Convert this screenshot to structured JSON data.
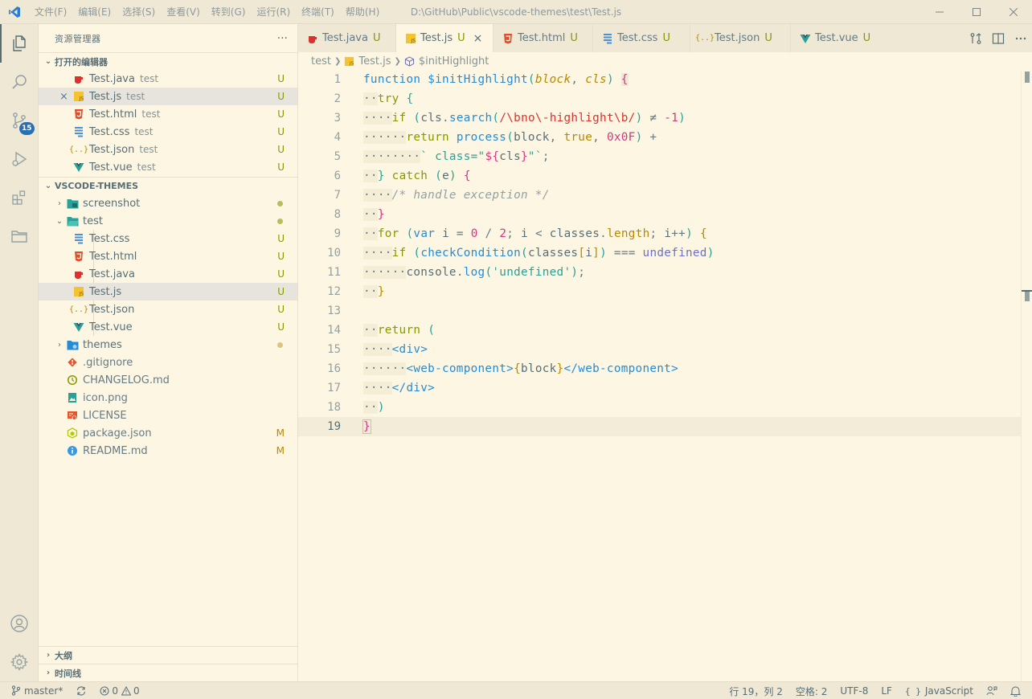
{
  "titlebar": {
    "menu": [
      "文件(F)",
      "编辑(E)",
      "选择(S)",
      "查看(V)",
      "转到(G)",
      "运行(R)",
      "终端(T)",
      "帮助(H)"
    ],
    "window_title": "D:\\GitHub\\Public\\vscode-themes\\test\\Test.js"
  },
  "activity": {
    "scm_badge": "15",
    "items": [
      "explorer-icon",
      "search-icon",
      "source-control-icon",
      "run-debug-icon",
      "extensions-icon",
      "folder-icon",
      "account-icon",
      "settings-gear-icon"
    ]
  },
  "sidebar": {
    "title": "资源管理器",
    "more": "···",
    "open_editors": {
      "label": "打开的编辑器",
      "items": [
        {
          "name": "Test.java",
          "desc": "test",
          "status": "U",
          "icon": "java"
        },
        {
          "name": "Test.js",
          "desc": "test",
          "status": "U",
          "icon": "js"
        },
        {
          "name": "Test.html",
          "desc": "test",
          "status": "U",
          "icon": "html"
        },
        {
          "name": "Test.css",
          "desc": "test",
          "status": "U",
          "icon": "css"
        },
        {
          "name": "Test.json",
          "desc": "test",
          "status": "U",
          "icon": "json"
        },
        {
          "name": "Test.vue",
          "desc": "test",
          "status": "U",
          "icon": "vue"
        }
      ]
    },
    "workspace": {
      "label": "VSCODE-THEMES",
      "screenshot": "screenshot",
      "test": "test",
      "test_files": [
        {
          "name": "Test.css",
          "status": "U",
          "icon": "css"
        },
        {
          "name": "Test.html",
          "status": "U",
          "icon": "html"
        },
        {
          "name": "Test.java",
          "status": "U",
          "icon": "java"
        },
        {
          "name": "Test.js",
          "status": "U",
          "icon": "js"
        },
        {
          "name": "Test.json",
          "status": "U",
          "icon": "json"
        },
        {
          "name": "Test.vue",
          "status": "U",
          "icon": "vue"
        }
      ],
      "themes": "themes",
      "root_files": [
        {
          "name": ".gitignore",
          "status": "",
          "icon": "git"
        },
        {
          "name": "CHANGELOG.md",
          "status": "",
          "icon": "changelog"
        },
        {
          "name": "icon.png",
          "status": "",
          "icon": "image"
        },
        {
          "name": "LICENSE",
          "status": "",
          "icon": "license"
        },
        {
          "name": "package.json",
          "status": "M",
          "icon": "npm"
        },
        {
          "name": "README.md",
          "status": "M",
          "icon": "info"
        }
      ]
    },
    "outline": "大纲",
    "timeline": "时间线"
  },
  "tabs": [
    {
      "name": "Test.java",
      "status": "U",
      "icon": "java"
    },
    {
      "name": "Test.js",
      "status": "U",
      "icon": "js",
      "close": "×"
    },
    {
      "name": "Test.html",
      "status": "U",
      "icon": "html"
    },
    {
      "name": "Test.css",
      "status": "U",
      "icon": "css"
    },
    {
      "name": "Test.json",
      "status": "U",
      "icon": "json"
    },
    {
      "name": "Test.vue",
      "status": "U",
      "icon": "vue"
    }
  ],
  "breadcrumb": {
    "folder": "test",
    "file": "Test.js",
    "symbol": "$initHighlight"
  },
  "code": {
    "line_numbers": [
      "1",
      "2",
      "3",
      "4",
      "5",
      "6",
      "7",
      "8",
      "9",
      "10",
      "11",
      "12",
      "13",
      "14",
      "15",
      "16",
      "17",
      "18",
      "19"
    ],
    "current_line": "19"
  },
  "statusbar": {
    "branch": "master*",
    "errors": "0",
    "warnings": "0",
    "position": "行 19，列 2",
    "spaces": "空格: 2",
    "encoding": "UTF-8",
    "eol": "LF",
    "language": "JavaScript"
  }
}
